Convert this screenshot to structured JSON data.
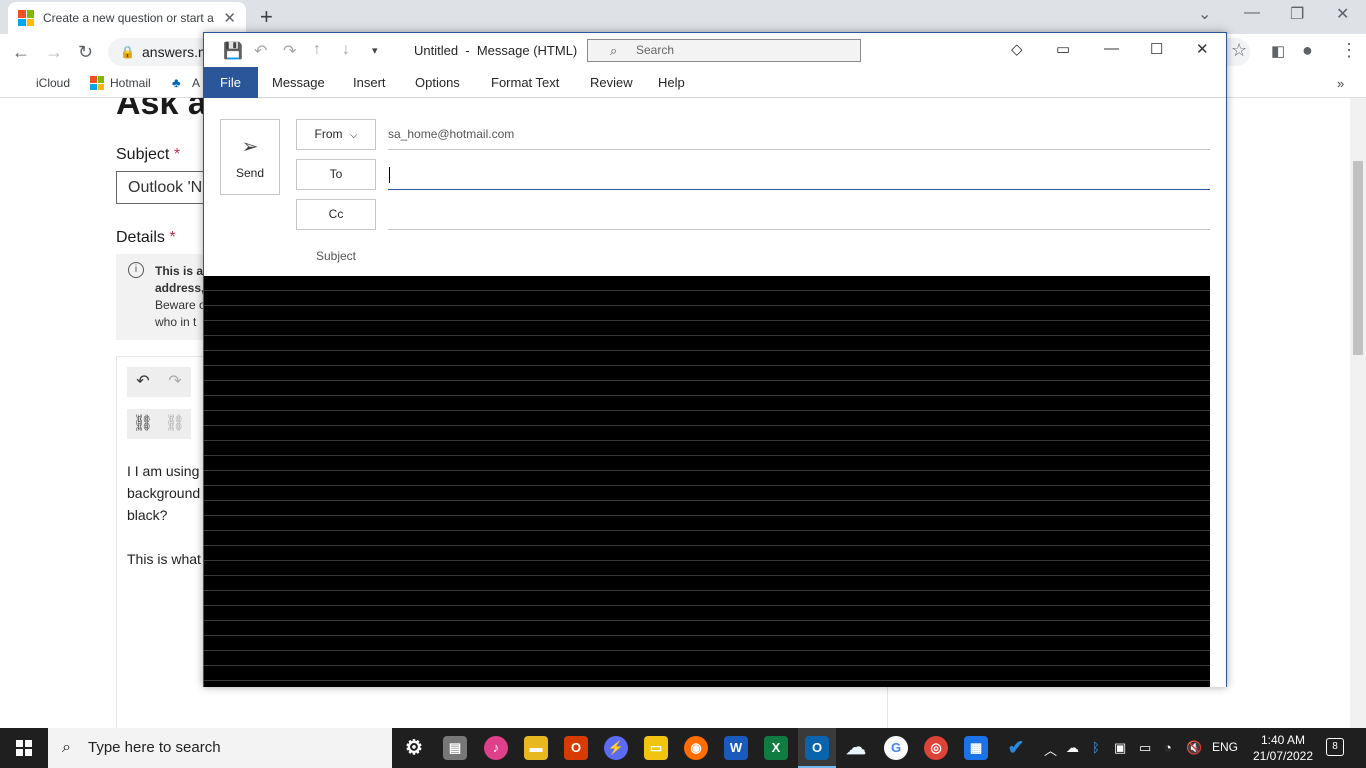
{
  "browser": {
    "tab_title": "Create a new question or start a discussion",
    "url": "answers.m",
    "bookmarks": [
      {
        "label": "iCloud"
      },
      {
        "label": "Hotmail"
      },
      {
        "label": "A"
      }
    ],
    "icons": [
      "back-icon",
      "forward-icon",
      "reload-icon",
      "lock-icon",
      "star-icon",
      "sidebar-icon",
      "profile-icon",
      "menu-icon"
    ]
  },
  "webpage": {
    "heading": "Ask a",
    "subject_label": "Subject",
    "required_mark": "*",
    "subject_value": "Outlook 'N",
    "details_label": "Details",
    "info_lines": [
      "This is a",
      "address,",
      "Beware o",
      "who in t"
    ],
    "body_lines": [
      "I I am using",
      "background",
      "black?",
      "This is what"
    ]
  },
  "outlook": {
    "title": "Untitled  -  Message (HTML)",
    "search_placeholder": "Search",
    "ribbon_tabs": [
      "File",
      "Message",
      "Insert",
      "Options",
      "Format Text",
      "Review",
      "Help"
    ],
    "send_label": "Send",
    "from_label": "From",
    "from_value": "sa_home@hotmail.com",
    "to_label": "To",
    "to_value": "",
    "cc_label": "Cc",
    "cc_value": "",
    "subject_label": "Subject",
    "body_background": "#000000",
    "accent": "#2b579a"
  },
  "taskbar": {
    "search_placeholder": "Type here to search",
    "language": "ENG",
    "time": "1:40 AM",
    "date": "21/07/2022",
    "notifications": "8"
  }
}
